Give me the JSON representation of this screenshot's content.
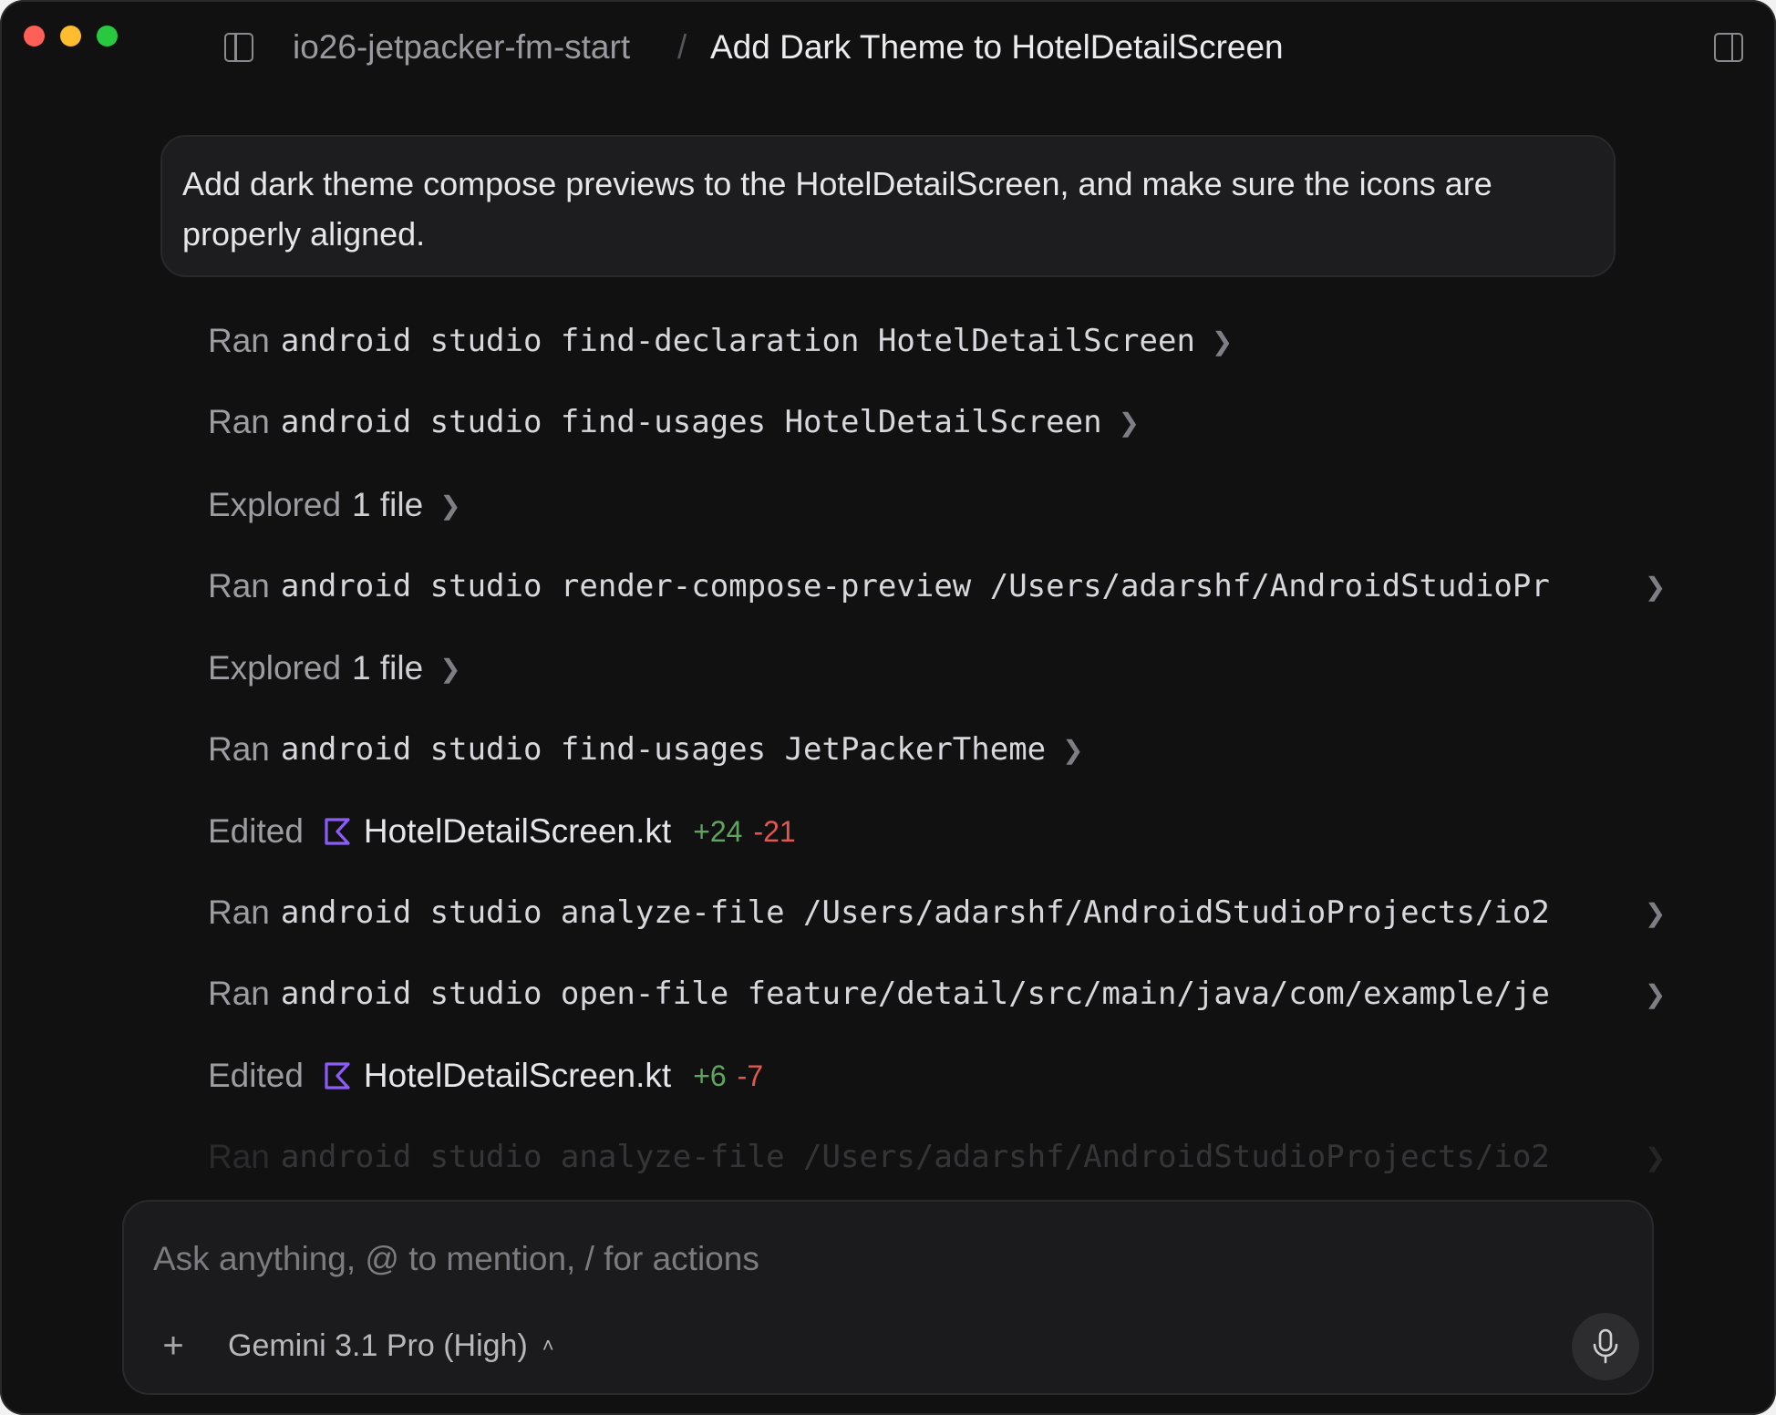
{
  "window": {
    "breadcrumb": {
      "project": "io26-jetpacker-fm-start",
      "separator": "/",
      "title": "Add Dark Theme to HotelDetailScreen"
    }
  },
  "prompt": {
    "text": "Add dark theme compose previews to the HotelDetailScreen, and make sure the icons are properly aligned."
  },
  "activity": [
    {
      "verb": "Ran",
      "command": "android studio find-declaration HotelDetailScreen"
    },
    {
      "verb": "Ran",
      "command": "android studio find-usages HotelDetailScreen"
    },
    {
      "verb": "Explored",
      "text": "1 file"
    },
    {
      "verb": "Ran",
      "command": "android studio render-compose-preview /Users/adarshf/AndroidStudioPr"
    },
    {
      "verb": "Explored",
      "text": "1 file"
    },
    {
      "verb": "Ran",
      "command": "android studio find-usages JetPackerTheme"
    },
    {
      "verb": "Edited",
      "file": "HotelDetailScreen.kt",
      "added": "+24",
      "removed": "-21"
    },
    {
      "verb": "Ran",
      "command": "android studio analyze-file /Users/adarshf/AndroidStudioProjects/io2"
    },
    {
      "verb": "Ran",
      "command": "android studio open-file feature/detail/src/main/java/com/example/je"
    },
    {
      "verb": "Edited",
      "file": "HotelDetailScreen.kt",
      "added": "+6",
      "removed": "-7"
    },
    {
      "verb": "Ran",
      "command": "android studio analyze-file /Users/adarshf/AndroidStudioProjects/io2"
    }
  ],
  "composer": {
    "placeholder": "Ask anything, @ to mention, / for actions",
    "model": "Gemini 3.1 Pro (High)"
  },
  "colors": {
    "background": "#111112",
    "added": "#5fa45f",
    "removed": "#e0584f",
    "kotlin_icon": "#8b5cf6"
  }
}
